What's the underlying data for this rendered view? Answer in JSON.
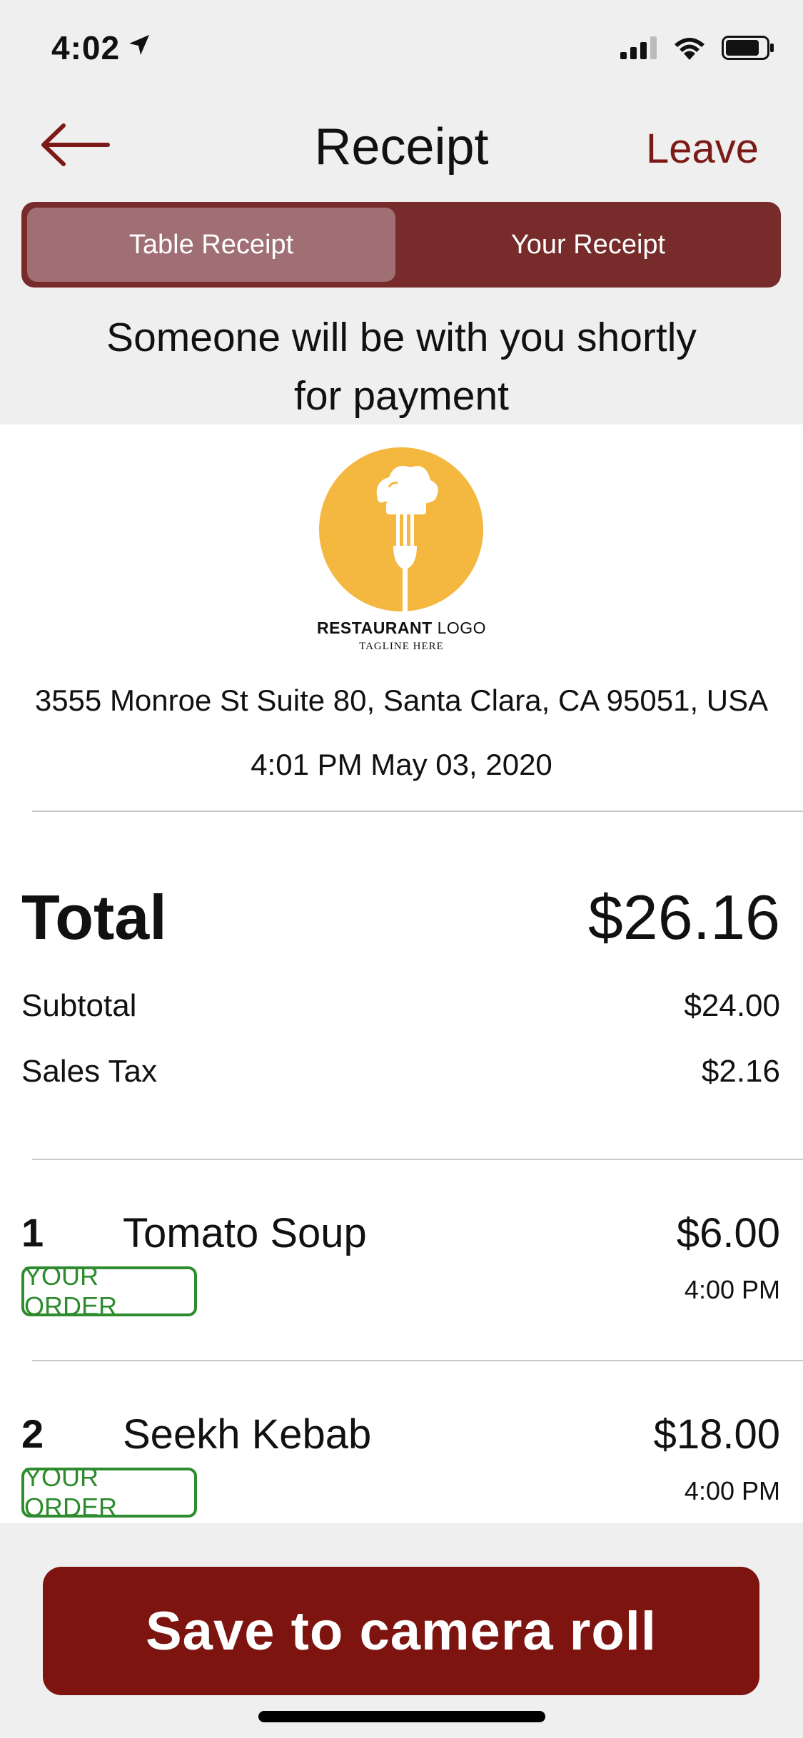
{
  "status_bar": {
    "time": "4:02"
  },
  "header": {
    "title": "Receipt",
    "leave_label": "Leave"
  },
  "tabs": [
    {
      "label": "Table Receipt",
      "selected": true
    },
    {
      "label": "Your Receipt",
      "selected": false
    }
  ],
  "message": {
    "line1": "Someone will be with you shortly",
    "line2": "for payment"
  },
  "restaurant": {
    "logo_text_bold": "RESTAURANT",
    "logo_text_thin": "LOGO",
    "tagline": "TAGLINE HERE",
    "address": "3555 Monroe St Suite 80, Santa Clara, CA 95051, USA",
    "datetime": "4:01 PM May 03, 2020"
  },
  "totals": {
    "total_label": "Total",
    "total_value": "$26.16",
    "subtotal_label": "Subtotal",
    "subtotal_value": "$24.00",
    "tax_label": "Sales Tax",
    "tax_value": "$2.16"
  },
  "items": [
    {
      "qty": "1",
      "name": "Tomato Soup",
      "price": "$6.00",
      "badge": "YOUR ORDER",
      "time": "4:00 PM"
    },
    {
      "qty": "2",
      "name": "Seekh Kebab",
      "price": "$18.00",
      "badge": "YOUR ORDER",
      "time": "4:00 PM"
    }
  ],
  "save_button": {
    "label": "Save to camera roll"
  },
  "colors": {
    "accent": "#7d1410",
    "segment_bg": "#772b2b",
    "segment_selected": "#a06f73",
    "badge_green": "#2e8b2e",
    "logo_yellow": "#f4b740"
  }
}
